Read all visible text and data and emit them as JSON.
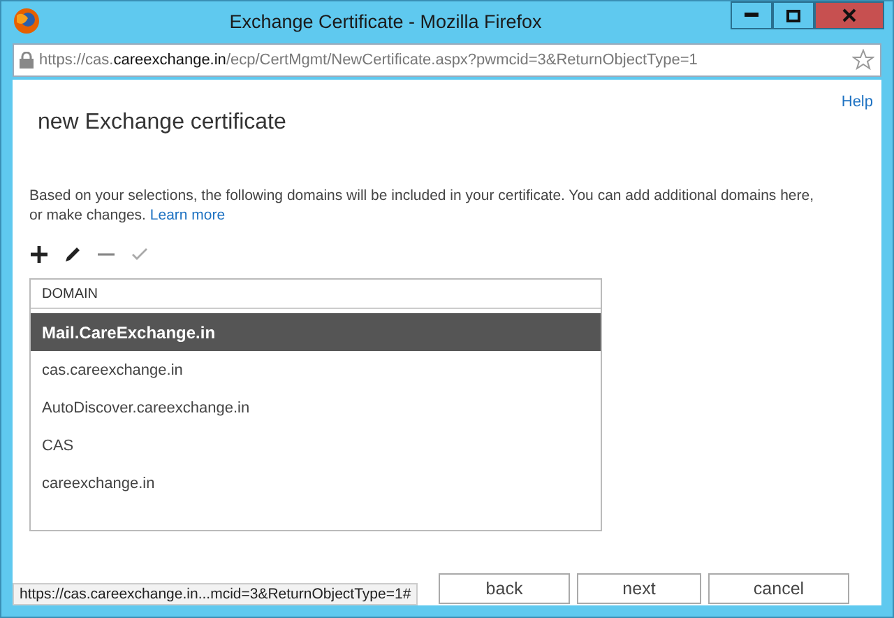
{
  "window": {
    "title": "Exchange Certificate - Mozilla Firefox"
  },
  "address_bar": {
    "scheme_prefix": "https://cas.",
    "host": "careexchange.in",
    "path": "/ecp/CertMgmt/NewCertificate.aspx?pwmcid=3&ReturnObjectType=1"
  },
  "help_link": "Help",
  "page_title": "new Exchange certificate",
  "description": "Based on your selections, the following domains will be included in your certificate. You can add additional domains here, or make changes.",
  "learn_more_link": "Learn more",
  "toolbar": [
    {
      "kind": "add",
      "disabled": false
    },
    {
      "kind": "edit",
      "disabled": false
    },
    {
      "kind": "remove",
      "disabled": false
    },
    {
      "kind": "check",
      "disabled": true
    }
  ],
  "table": {
    "columns": [
      "DOMAIN"
    ],
    "rows": [
      {
        "domain": "Mail.CareExchange.in",
        "selected": true
      },
      {
        "domain": "cas.careexchange.in",
        "selected": false
      },
      {
        "domain": "AutoDiscover.careexchange.in",
        "selected": false
      },
      {
        "domain": "CAS",
        "selected": false
      },
      {
        "domain": "careexchange.in",
        "selected": false
      }
    ]
  },
  "buttons": [
    "back",
    "next",
    "cancel"
  ],
  "status_bar": "https://cas.careexchange.in...mcid=3&ReturnObjectType=1#"
}
